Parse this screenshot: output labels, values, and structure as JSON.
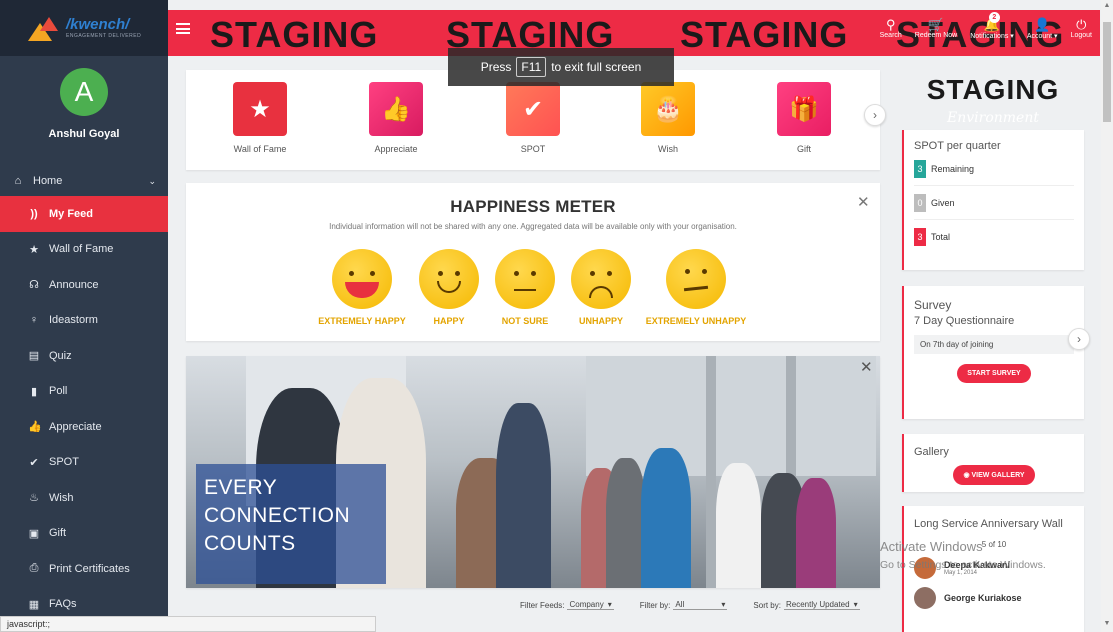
{
  "brand": {
    "name": "/kwench/",
    "tagline": "ENGAGEMENT DELIVERED"
  },
  "user": {
    "initial": "A",
    "name": "Anshul Goyal"
  },
  "sidebar": {
    "home_label": "Home",
    "items": [
      {
        "label": "My Feed",
        "icon": "rss-icon"
      },
      {
        "label": "Wall of Fame",
        "icon": "star-icon"
      },
      {
        "label": "Announce",
        "icon": "megaphone-icon"
      },
      {
        "label": "Ideastorm",
        "icon": "bulb-icon"
      },
      {
        "label": "Quiz",
        "icon": "quiz-icon"
      },
      {
        "label": "Poll",
        "icon": "bar-chart-icon"
      },
      {
        "label": "Appreciate",
        "icon": "thumbs-up-icon"
      },
      {
        "label": "SPOT",
        "icon": "check-shield-icon"
      },
      {
        "label": "Wish",
        "icon": "cake-icon"
      },
      {
        "label": "Gift",
        "icon": "gift-icon"
      },
      {
        "label": "Print Certificates",
        "icon": "printer-icon"
      },
      {
        "label": "FAQs",
        "icon": "faq-icon"
      }
    ]
  },
  "topbar": {
    "staging_text": "STAGING",
    "actions": [
      {
        "label": "Search",
        "icon": "search-icon"
      },
      {
        "label": "Redeem Now",
        "icon": "cart-icon"
      },
      {
        "label": "Notifications ▾",
        "icon": "bell-icon",
        "badge": "2"
      },
      {
        "label": "Account ▾",
        "icon": "user-icon"
      },
      {
        "label": "Logout",
        "icon": "power-icon"
      }
    ]
  },
  "toast": {
    "prefix": "Press",
    "key": "F11",
    "suffix": "to exit full screen"
  },
  "quick_actions": [
    {
      "label": "Wall of Fame",
      "color": "#e8313f",
      "glyph": "★"
    },
    {
      "label": "Appreciate",
      "color": "#e8246a",
      "glyph": "👍"
    },
    {
      "label": "SPOT",
      "color": "#ff6a4d",
      "glyph": "✔"
    },
    {
      "label": "Wish",
      "color": "#ffb300",
      "glyph": "🎂"
    },
    {
      "label": "Gift",
      "color": "#e8246a",
      "glyph": "🎁"
    }
  ],
  "happiness": {
    "title": "HAPPINESS METER",
    "subtitle": "Individual information will not be shared with any one. Aggregated data will be available only with your organisation.",
    "options": [
      "EXTREMELY HAPPY",
      "HAPPY",
      "NOT SURE",
      "UNHAPPY",
      "EXTREMELY UNHAPPY"
    ]
  },
  "banner": {
    "line1": "EVERY",
    "line2": "CONNECTION",
    "line3": "COUNTS"
  },
  "filters": {
    "feeds_label": "Filter Feeds:",
    "feeds_value": "Company",
    "by_label": "Filter by:",
    "by_value": "All",
    "sort_label": "Sort by:",
    "sort_value": "Recently Updated"
  },
  "right": {
    "staging": "STAGING",
    "environment": "Environment",
    "spot": {
      "title": "SPOT per quarter",
      "rows": [
        {
          "count": "3",
          "label": "Remaining",
          "color": "#26a69a"
        },
        {
          "count": "0",
          "label": "Given",
          "color": "#bdbdbd"
        },
        {
          "count": "3",
          "label": "Total",
          "color": "#ed2b45"
        }
      ]
    },
    "survey": {
      "title": "Survey",
      "subtitle": "7 Day Questionnaire",
      "info": "On 7th day of joining",
      "button": "START SURVEY"
    },
    "gallery": {
      "title": "Gallery",
      "button": "VIEW GALLERY"
    },
    "lsaw": {
      "title": "Long Service Anniversary Wall",
      "count_text": "5 of 10",
      "people": [
        {
          "name": "Deepa Kakwani",
          "date": "May 1, 2014"
        },
        {
          "name": "George Kuriakose",
          "date": ""
        }
      ]
    }
  },
  "watermark": {
    "line1": "Activate Windows",
    "line2": "Go to Settings to activate Windows."
  },
  "status_bar": "javascript:;"
}
